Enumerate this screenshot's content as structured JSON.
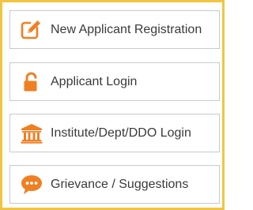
{
  "colors": {
    "accent": "#f07f22",
    "frame": "#f2c541",
    "item_border": "#c9c9c9",
    "text": "#3a3a3a"
  },
  "menu": {
    "items": [
      {
        "label": "New Applicant Registration",
        "icon": "edit-icon"
      },
      {
        "label": "Applicant Login",
        "icon": "unlock-icon"
      },
      {
        "label": "Institute/Dept/DDO Login",
        "icon": "institution-icon"
      },
      {
        "label": "Grievance / Suggestions",
        "icon": "chat-bubble-icon"
      }
    ]
  }
}
